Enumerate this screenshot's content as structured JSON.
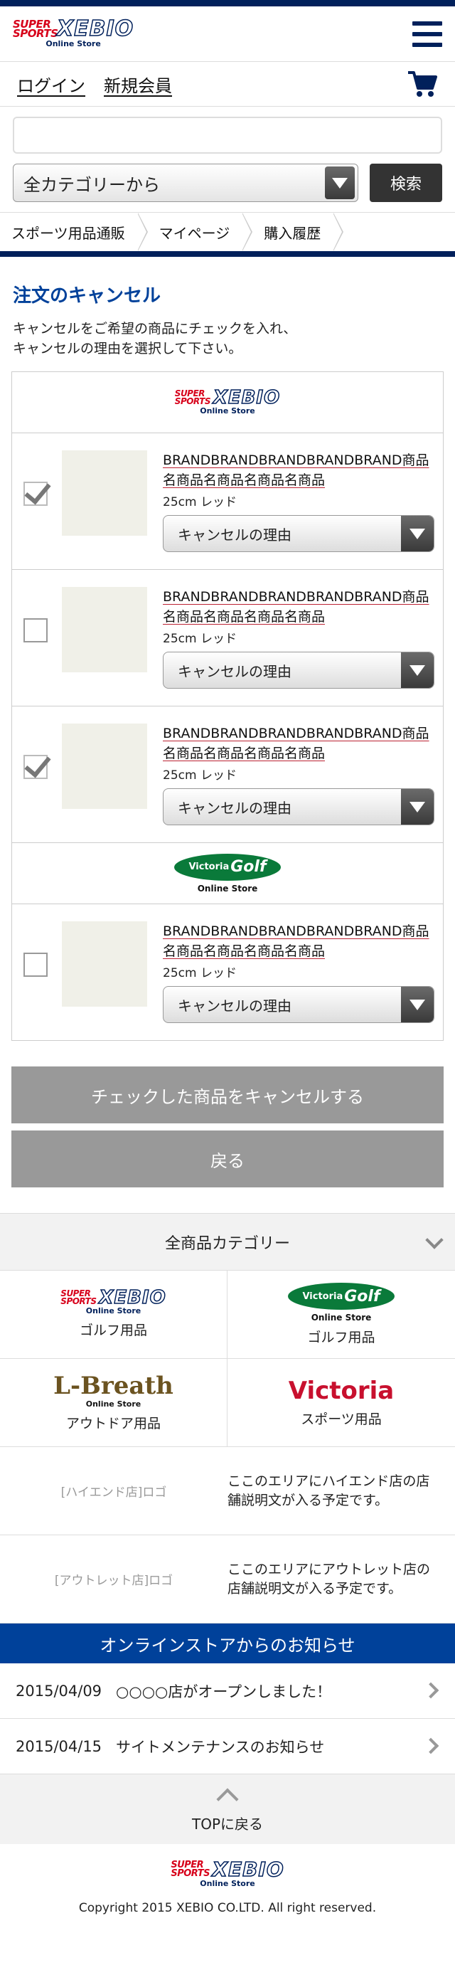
{
  "header": {
    "logo": {
      "super": "SUPER SPORTS",
      "main": "XEBIO",
      "sub": "Online Store"
    },
    "nav": {
      "login": "ログイン",
      "register": "新規会員"
    }
  },
  "search": {
    "placeholder": "",
    "category": "全カテゴリーから",
    "button": "検索"
  },
  "breadcrumb": [
    "スポーツ用品通販",
    "マイページ",
    "購入履歴"
  ],
  "page": {
    "title": "注文のキャンセル",
    "desc_line1": "キャンセルをご希望の商品にチェックを入れ、",
    "desc_line2": "キャンセルの理由を選択して下さい。"
  },
  "orders": {
    "brand_xebio": {
      "super": "SUPER SPORTS",
      "main": "XEBIO",
      "sub": "Online Store"
    },
    "brand_vg": {
      "small": "Victoria",
      "big": "Golf",
      "sub": "Online Store"
    },
    "items": [
      {
        "name": "BRANDBRANDBRANDBRANDBRAND商品名商品名商品名商品名商品",
        "variant": "25cm レッド",
        "reason": "キャンセルの理由",
        "checked": true
      },
      {
        "name": "BRANDBRANDBRANDBRANDBRAND商品名商品名商品名商品名商品",
        "variant": "25cm レッド",
        "reason": "キャンセルの理由",
        "checked": false
      },
      {
        "name": "BRANDBRANDBRANDBRANDBRAND商品名商品名商品名商品名商品",
        "variant": "25cm レッド",
        "reason": "キャンセルの理由",
        "checked": true
      },
      {
        "name": "BRANDBRANDBRANDBRANDBRAND商品名商品名商品名商品名商品",
        "variant": "25cm レッド",
        "reason": "キャンセルの理由",
        "checked": false
      }
    ]
  },
  "actions": {
    "cancel_checked": "チェックした商品をキャンセルする",
    "back": "戻る"
  },
  "categories": {
    "title": "全商品カテゴリー",
    "items": [
      {
        "logo": "XEBIO",
        "logo_sub": "Online Store",
        "logo_super": "SUPER SPORTS",
        "label": "ゴルフ用品"
      },
      {
        "logo_small": "Victoria",
        "logo": "Golf",
        "logo_sub": "Online Store",
        "label": "ゴルフ用品"
      },
      {
        "logo": "L-Breath",
        "logo_sub": "Online Store",
        "label": "アウトドア用品"
      },
      {
        "logo": "Victoria",
        "label": "スポーツ用品"
      }
    ]
  },
  "stores": [
    {
      "logo": "[ハイエンド店]ロゴ",
      "desc": "ここのエリアにハイエンド店の店舗説明文が入る予定です。"
    },
    {
      "logo": "[アウトレット店]ロゴ",
      "desc": "ここのエリアにアウトレット店の店舗説明文が入る予定です。"
    }
  ],
  "news": {
    "title": "オンラインストアからのお知らせ",
    "items": [
      {
        "date": "2015/04/09",
        "text": "○○○○店がオープンしました！"
      },
      {
        "date": "2015/04/15",
        "text": "サイトメンテナンスのお知らせ"
      }
    ]
  },
  "footer": {
    "totop": "TOPに戻る",
    "logo": {
      "super": "SUPER SPORTS",
      "main": "XEBIO",
      "sub": "Online Store"
    },
    "copyright": "Copyright 2015 XEBIO CO.LTD. All right reserved."
  },
  "colors": {
    "navy": "#00205b",
    "accent_blue": "#00419a",
    "brand_red": "#d7001a",
    "golf_green": "#0a7a3a",
    "button_gray": "#999999"
  }
}
